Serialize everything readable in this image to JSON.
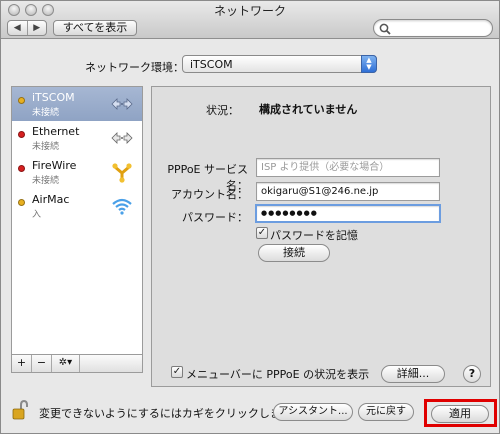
{
  "window": {
    "title": "ネットワーク"
  },
  "toolbar": {
    "back_glyph": "◀",
    "forward_glyph": "▶",
    "show_all_label": "すべてを表示",
    "search_placeholder": ""
  },
  "location": {
    "label": "ネットワーク環境：",
    "value": "iTSCOM"
  },
  "services": [
    {
      "name": "iTSCOM",
      "status": "未接続",
      "status_color": "#e8b020",
      "icon": "ppp-arrows-icon"
    },
    {
      "name": "Ethernet",
      "status": "未接続",
      "status_color": "#d62020",
      "icon": "ethernet-arrows-icon"
    },
    {
      "name": "FireWire",
      "status": "未接続",
      "status_color": "#d62020",
      "icon": "firewire-icon"
    },
    {
      "name": "AirMac",
      "status": "入",
      "status_color": "#e8b020",
      "icon": "wifi-icon"
    }
  ],
  "sidebar_controls": {
    "add": "+",
    "remove": "−",
    "gear": "✲▾"
  },
  "detail": {
    "status_label": "状況：",
    "status_value": "構成されていません",
    "pppoe_service_label": "PPPoE サービス名：",
    "pppoe_service_placeholder": "ISP より提供（必要な場合）",
    "account_label": "アカウント名：",
    "account_value": "okigaru@S1@246.ne.jp",
    "password_label": "パスワード：",
    "password_value": "●●●●●●●●",
    "remember_password_label": "パスワードを記憶",
    "remember_password_checked": true,
    "connect_button": "接続",
    "menubar_checkbox_label": "メニューバーに PPPoE の状況を表示",
    "menubar_checked": true,
    "advanced_button": "詳細...",
    "help_button": "?"
  },
  "footer": {
    "lock_message": "変更できないようにするにはカギをクリックします。",
    "assistant_button": "アシスタント...",
    "revert_button": "元に戻す",
    "apply_button": "適用"
  },
  "colors": {
    "selected_row": "#94a8c8",
    "highlight": "#e00000",
    "focus_ring": "#6c9de0"
  }
}
